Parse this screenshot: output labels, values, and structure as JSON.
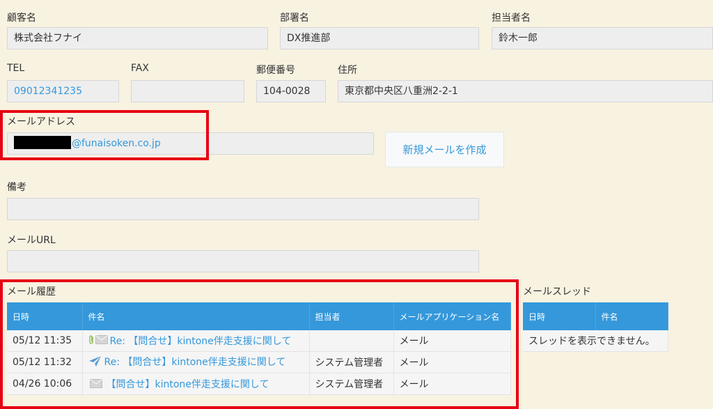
{
  "customer": {
    "customer_label": "顧客名",
    "customer_value": "株式会社フナイ",
    "dept_label": "部署名",
    "dept_value": "DX推進部",
    "staff_label": "担当者名",
    "staff_value": "鈴木一郎"
  },
  "contact": {
    "tel_label": "TEL",
    "tel_value": "09012341235",
    "fax_label": "FAX",
    "fax_value": "",
    "zip_label": "郵便番号",
    "zip_value": "104-0028",
    "address_label": "住所",
    "address_value": "東京都中央区八重洲2-2-1"
  },
  "email": {
    "label": "メールアドレス",
    "domain": "@funaisoken.co.jp",
    "compose_button": "新規メールを作成"
  },
  "notes": {
    "label": "備考",
    "value": ""
  },
  "mail_url": {
    "label": "メールURL",
    "value": ""
  },
  "history": {
    "title": "メール履歴",
    "columns": [
      "日時",
      "件名",
      "担当者",
      "メールアプリケーション名"
    ],
    "rows": [
      {
        "datetime": "05/12 11:35",
        "icon": "attachment-mail-icon",
        "subject": "Re: 【問合せ】kintone伴走支援に関して",
        "staff": "",
        "app": "メール"
      },
      {
        "datetime": "05/12 11:32",
        "icon": "sent-icon",
        "subject": "Re: 【問合せ】kintone伴走支援に関して",
        "staff": "システム管理者",
        "app": "メール"
      },
      {
        "datetime": "04/26 10:06",
        "icon": "mail-icon",
        "subject": "【問合せ】kintone伴走支援に関して",
        "staff": "システム管理者",
        "app": "メール"
      }
    ]
  },
  "thread": {
    "title": "メールスレッド",
    "columns": [
      "日時",
      "件名"
    ],
    "empty_message": "スレッドを表示できません。"
  },
  "colors": {
    "background": "#f8f2e1",
    "header_blue": "#3498db",
    "highlight_red": "#e60012",
    "link_blue": "#3498db"
  }
}
